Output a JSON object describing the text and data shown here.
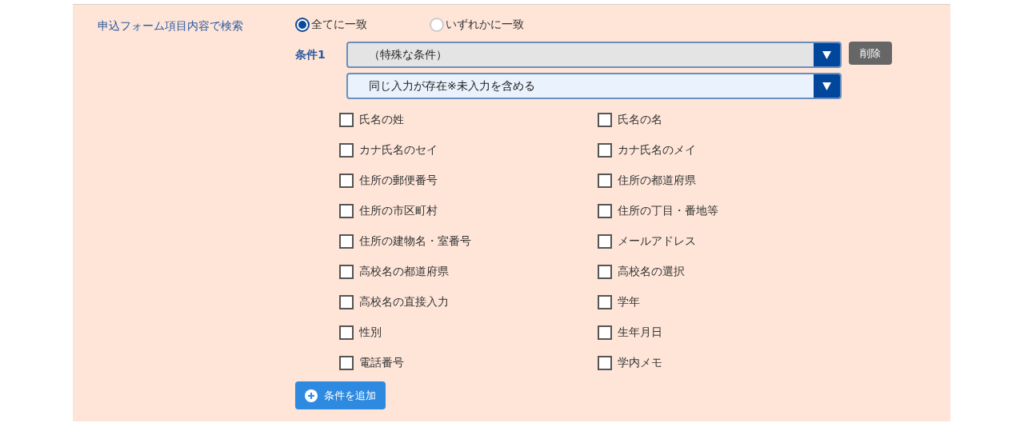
{
  "search_label": "申込フォーム項目内容で検索",
  "match_options": [
    {
      "label": "全てに一致",
      "selected": true
    },
    {
      "label": "いずれかに一致",
      "selected": false
    }
  ],
  "condition": {
    "label": "条件1",
    "type_select": {
      "value": "（特殊な条件）"
    },
    "rule_select": {
      "value": "同じ入力が存在※未入力を含める"
    },
    "delete_button": "削除"
  },
  "fields": [
    {
      "label": "氏名の姓",
      "checked": false
    },
    {
      "label": "氏名の名",
      "checked": false
    },
    {
      "label": "カナ氏名のセイ",
      "checked": false
    },
    {
      "label": "カナ氏名のメイ",
      "checked": false
    },
    {
      "label": "住所の郵便番号",
      "checked": false
    },
    {
      "label": "住所の都道府県",
      "checked": false
    },
    {
      "label": "住所の市区町村",
      "checked": false
    },
    {
      "label": "住所の丁目・番地等",
      "checked": false
    },
    {
      "label": "住所の建物名・室番号",
      "checked": false
    },
    {
      "label": "メールアドレス",
      "checked": false
    },
    {
      "label": "高校名の都道府県",
      "checked": false
    },
    {
      "label": "高校名の選択",
      "checked": false
    },
    {
      "label": "高校名の直接入力",
      "checked": false
    },
    {
      "label": "学年",
      "checked": false
    },
    {
      "label": "性別",
      "checked": false
    },
    {
      "label": "生年月日",
      "checked": false
    },
    {
      "label": "電話番号",
      "checked": false
    },
    {
      "label": "学内メモ",
      "checked": false
    }
  ],
  "add_button": "条件を追加"
}
